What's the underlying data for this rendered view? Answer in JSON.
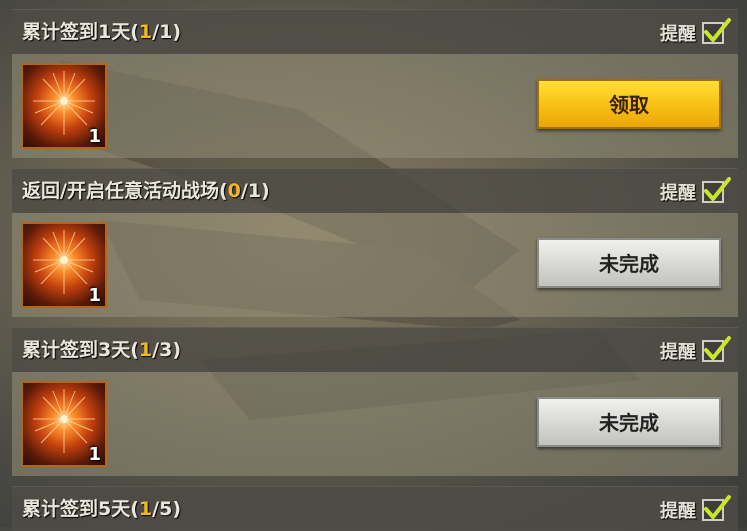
{
  "remind_label": "提醒",
  "tasks": [
    {
      "title": "累计签到1天",
      "progress_open": "(",
      "progress_current": "1",
      "progress_rest": "/1)",
      "reward_count": "1",
      "button_label": "领取",
      "button_state": "claim",
      "reminder_checked": true
    },
    {
      "title": "返回/开启任意活动战场",
      "progress_open": "(",
      "progress_current": "0",
      "progress_rest": "/1)",
      "reward_count": "1",
      "button_label": "未完成",
      "button_state": "incomplete",
      "reminder_checked": true
    },
    {
      "title": "累计签到3天",
      "progress_open": "(",
      "progress_current": "1",
      "progress_rest": "/3)",
      "reward_count": "1",
      "button_label": "未完成",
      "button_state": "incomplete",
      "reminder_checked": true
    },
    {
      "title": "累计签到5天",
      "progress_open": "(",
      "progress_current": "1",
      "progress_rest": "/5)",
      "reminder_checked": true
    }
  ],
  "icons": {
    "reward": "firework-icon",
    "check": "checkmark-icon"
  },
  "colors": {
    "progress_highlight": "#f2b822",
    "claim_button": "#f9c215",
    "incomplete_button": "#d9d9d6",
    "checkmark": "#c8e62a"
  }
}
